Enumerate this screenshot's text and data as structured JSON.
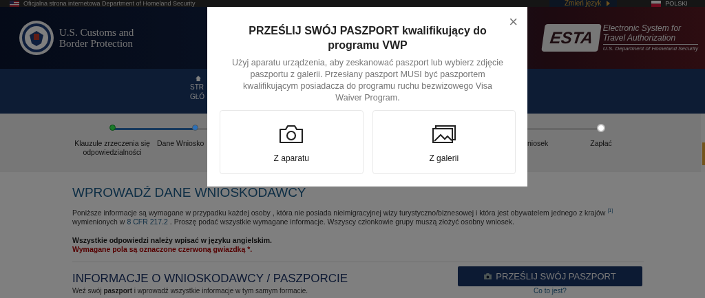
{
  "top_bar": {
    "notice": "Oficjalna strona internetowa Department of Homeland Security",
    "language_link": "Zmień język",
    "language": "POLSKI"
  },
  "header": {
    "agency_line_1": "U.S. Customs and",
    "agency_line_2": "Border Protection",
    "esta_mark": "ESTA",
    "esta_line_1": "Electronic System for",
    "esta_line_2": "Travel Authorization",
    "esta_line_3": "U.S. Department of Homeland Security"
  },
  "nav": {
    "item_line_1": "STR",
    "item_line_2": "GŁÓ"
  },
  "steps": [
    {
      "label": "Klauzule zrzeczenia się odpowiedzialności",
      "kind": "full",
      "completed": true,
      "selected": false
    },
    {
      "label": "Dane Wniosko",
      "kind": "full",
      "completed": false,
      "selected": true
    },
    {
      "label": "niosek",
      "kind": "label"
    },
    {
      "label": "Zapłać",
      "kind": "full",
      "completed": false,
      "selected": false
    }
  ],
  "content": {
    "heading": "WPROWADŹ DANE WNIOSKODAWCY",
    "intro": [
      {
        "kind": "text",
        "text": "Poniższe informacje są wymagane w przypadku każdej osoby , która nie posiada nieimigracyjnej wizy turystyczno/biznesowej i która jest obywatelem jednego z krajów "
      },
      {
        "kind": "sup",
        "text": "[1]"
      },
      {
        "kind": "text",
        "text": " wymienionych w "
      },
      {
        "kind": "link",
        "text": "8 CFR 217.2"
      },
      {
        "kind": "text",
        "text": " . Proszę podać wszystkie wymagane informacje. Wszyscy członkowie grupy muszą złożyć osobny wniosek."
      }
    ],
    "english_note": "Wszystkie odpowiedzi należy wpisać w języku angielskim.",
    "required_note": "Wymagane pola są oznaczone czerwoną gwiazdką *.",
    "section_heading": "INFORMACJE O WNIOSKODAWCY / PASZPORCIE",
    "section_text": "Weź swój **paszport** i wprowadź wszystkie informacje w tym samym formacie.",
    "upload_button": "PRZEŚLIJ SWÓJ PASZPORT",
    "help_link": "Co to jest?"
  },
  "modal": {
    "title": "PRZEŚLIJ SWÓJ PASZPORT kwalifikujący do programu VWP",
    "close": "×",
    "description": "Użyj aparatu urządzenia, aby zeskanować paszport lub wybierz zdjęcie paszportu z galerii.  Przesłany paszport MUSI być paszportem kwalifikującym posiadacza do programu ruchu bezwizowego Visa Waiver Program.",
    "options": [
      {
        "kind": "camera",
        "label": "Z aparatu"
      },
      {
        "kind": "gallery",
        "label": "Z galerii"
      }
    ]
  }
}
